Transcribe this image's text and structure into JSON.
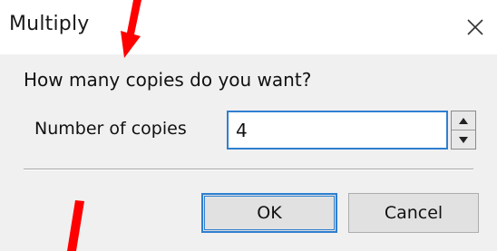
{
  "dialog": {
    "title": "Multiply",
    "close_icon": "close-icon",
    "prompt": "How many copies do you want?",
    "field_label": "Number of copies",
    "copies_value": "4",
    "spinner_icons": [
      "chevron-up-icon",
      "chevron-down-icon"
    ],
    "ok_label": "OK",
    "cancel_label": "Cancel"
  },
  "annotations": {
    "arrow_color": "#ff0000",
    "focus_color": "#2f7fd0"
  }
}
